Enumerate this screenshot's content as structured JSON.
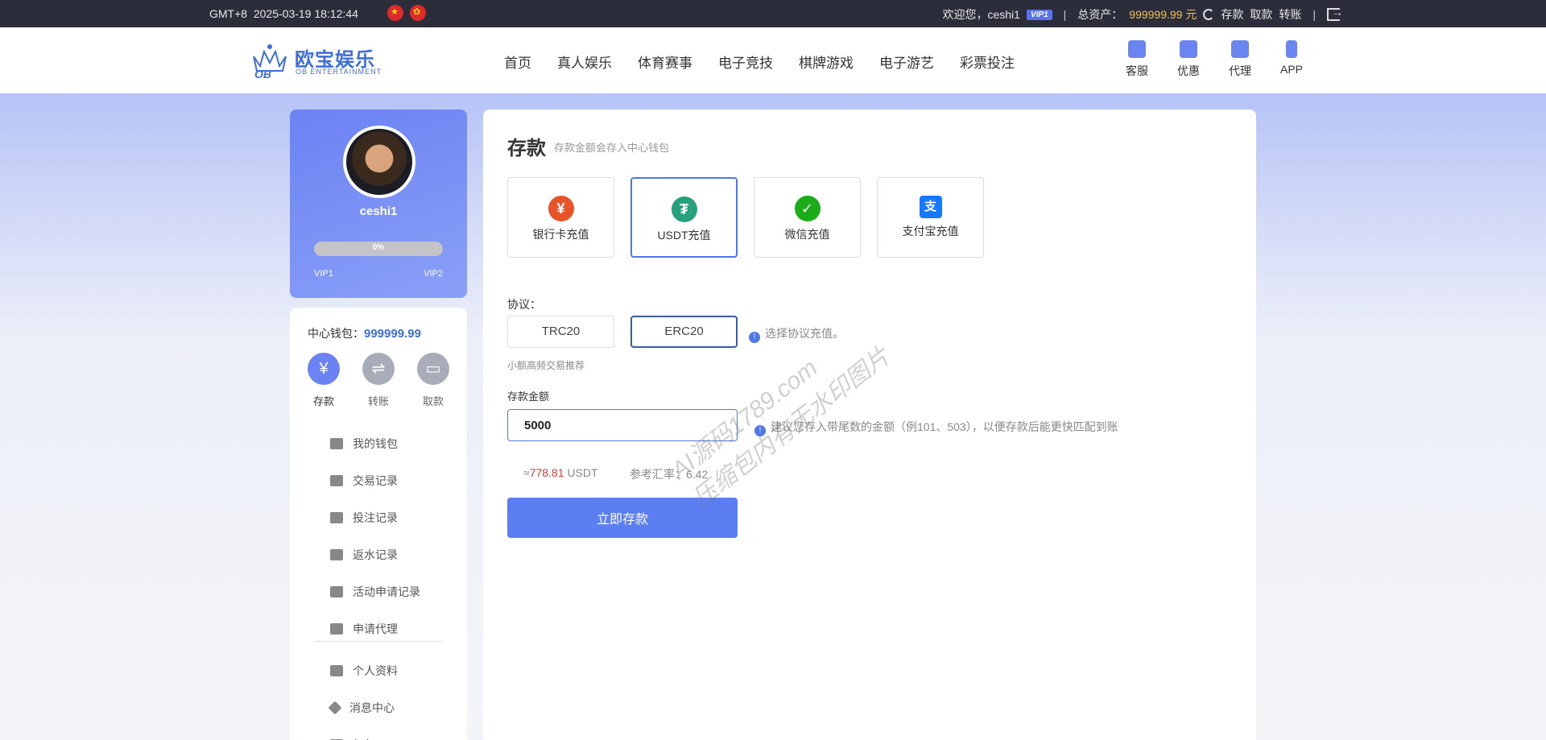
{
  "topbar": {
    "timezone": "GMT+8",
    "datetime": "2025-03-19 18:12:44",
    "welcome": "欢迎您，ceshi1",
    "vip_badge": "VIP1",
    "separator": "|",
    "assets_label": "总资产：",
    "assets_value": "999999.99 元",
    "links": [
      "存款",
      "取款",
      "转账"
    ]
  },
  "header": {
    "logo_title": "欧宝娱乐",
    "logo_sub": "OB ENTERTAINMENT",
    "nav": [
      "首页",
      "真人娱乐",
      "体育赛事",
      "电子竞技",
      "棋牌游戏",
      "电子游艺",
      "彩票投注"
    ],
    "tools": [
      "客服",
      "优惠",
      "代理",
      "APP"
    ]
  },
  "profile": {
    "username": "ceshi1",
    "progress_text": "0%",
    "progress_value": 0,
    "vip_current": "VIP1",
    "vip_next": "VIP2"
  },
  "sidebar": {
    "wallet_label": "中心钱包：",
    "wallet_value": "999999.99",
    "actions": [
      {
        "label": "存款",
        "icon": "¥"
      },
      {
        "label": "转账",
        "icon": "⇌"
      },
      {
        "label": "取款",
        "icon": "▭"
      }
    ],
    "menu": [
      "我的钱包",
      "交易记录",
      "投注记录",
      "返水记录",
      "活动申请记录",
      "申请代理"
    ],
    "menu2": [
      "个人资料",
      "消息中心",
      "红包"
    ]
  },
  "deposit": {
    "title": "存款",
    "subtitle": "存款金额会存入中心钱包",
    "methods": [
      {
        "label": "银行卡充值",
        "icon": "¥",
        "color": "#e8542a"
      },
      {
        "label": "USDT充值",
        "icon": "₮",
        "color": "#26a17b"
      },
      {
        "label": "微信充值",
        "icon": "✓",
        "color": "#1aad19"
      },
      {
        "label": "支付宝充值",
        "icon": "支",
        "color": "#1677ff"
      }
    ],
    "protocol_label": "协议：",
    "protocols": [
      "TRC20",
      "ERC20"
    ],
    "protocol_hint": "选择协议充值。",
    "protocol_small": "小额高频交易推荐",
    "amount_label": "存款金额",
    "amount_value": "5000",
    "amount_hint": "建议您存入带尾数的金额（例101、503），以便存款后能更快匹配到账",
    "conv_prefix": "≈",
    "conv_value": "778.81",
    "conv_unit": " USDT",
    "rate_text": "参考汇率：6.42",
    "submit_label": "立即存款"
  },
  "watermark": [
    "AI源码1789.com",
    "压缩包内有无水印图片"
  ]
}
